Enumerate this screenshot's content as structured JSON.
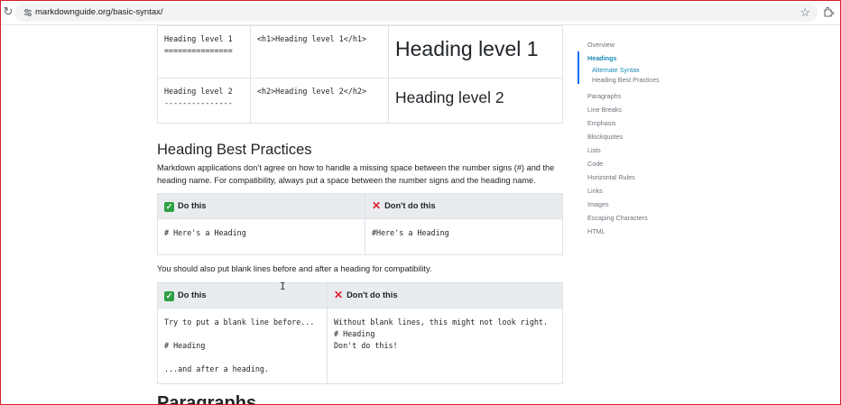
{
  "browser": {
    "url": "markdownguide.org/basic-syntax/"
  },
  "heading_table": {
    "rows": [
      {
        "markdown_line1": "Heading level 1",
        "markdown_line2": "===============",
        "html": "<h1>Heading level 1</h1>",
        "rendered": "Heading level 1"
      },
      {
        "markdown_line1": "Heading level 2",
        "markdown_line2": "---------------",
        "html": "<h2>Heading level 2</h2>",
        "rendered": "Heading level 2"
      }
    ]
  },
  "best_practices": {
    "title": "Heading Best Practices",
    "intro_line1": "Markdown applications don’t agree on how to handle a missing space between the number signs (#) and the",
    "intro_line2": "heading name. For compatibility, always put a space between the number signs and the heading name.",
    "table1": {
      "do_label": "Do this",
      "dont_label": "Don't do this",
      "do_code": "# Here's a Heading",
      "dont_code": "#Here's a Heading"
    },
    "blank_lines_text": "You should also put blank lines before and after a heading for compatibility.",
    "table2": {
      "do_label": "Do this",
      "dont_label": "Don't do this",
      "do_lines": [
        "Try to put a blank line before...",
        "",
        "# Heading",
        "",
        "...and after a heading."
      ],
      "dont_lines": [
        "Without blank lines, this might not look right.",
        "# Heading",
        "Don't do this!"
      ]
    }
  },
  "next_heading": "Paragraphs",
  "toc": {
    "items": [
      {
        "label": "Overview"
      },
      {
        "label": "Headings"
      },
      {
        "label": "Alternate Syntax"
      },
      {
        "label": "Heading Best Practices"
      },
      {
        "label": "Paragraphs"
      },
      {
        "label": "Line Breaks"
      },
      {
        "label": "Emphasis"
      },
      {
        "label": "Blockquotes"
      },
      {
        "label": "Lists"
      },
      {
        "label": "Code"
      },
      {
        "label": "Horizontal Rules"
      },
      {
        "label": "Links"
      },
      {
        "label": "Images"
      },
      {
        "label": "Escaping Characters"
      },
      {
        "label": "HTML"
      }
    ]
  },
  "colors": {
    "accent": "#1a8bb8",
    "frame": "#d9202e"
  }
}
